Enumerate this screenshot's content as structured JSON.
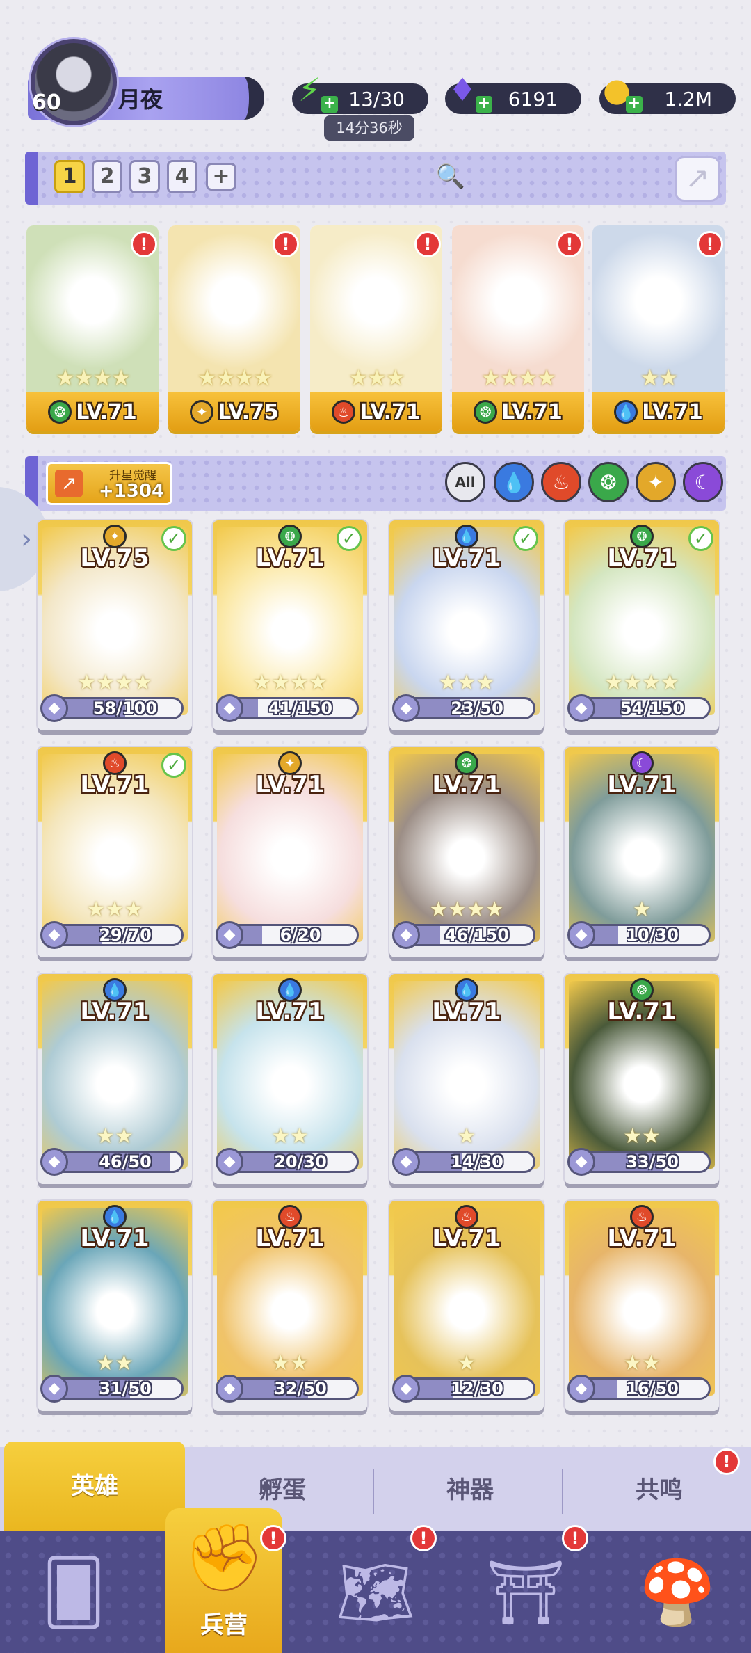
{
  "player": {
    "level": "60",
    "name": "月夜"
  },
  "resources": {
    "energy": "13/30",
    "energy_timer": "14分36秒",
    "gems": "6191",
    "gold": "1.2M"
  },
  "team_tabs": [
    "1",
    "2",
    "3",
    "4",
    "+"
  ],
  "team": [
    {
      "level": "LV.71",
      "stars": "★★★★",
      "element": "wind",
      "element_color": "#3aa84a"
    },
    {
      "level": "LV.75",
      "stars": "★★★★",
      "element": "light",
      "element_color": "#e3a82a"
    },
    {
      "level": "LV.71",
      "stars": "★★★",
      "element": "fire",
      "element_color": "#e04a2a"
    },
    {
      "level": "LV.71",
      "stars": "★★★★",
      "element": "wind",
      "element_color": "#3aa84a"
    },
    {
      "level": "LV.71",
      "stars": "★★",
      "element": "water",
      "element_color": "#3a7ae0"
    }
  ],
  "awaken": {
    "title": "升星觉醒",
    "value": "+1304"
  },
  "filters": [
    {
      "label": "All",
      "color": "#e8e8ee",
      "icon": "all"
    },
    {
      "label": "",
      "color": "#3a7ae0",
      "icon": "water"
    },
    {
      "label": "",
      "color": "#e04a2a",
      "icon": "fire"
    },
    {
      "label": "",
      "color": "#3aa84a",
      "icon": "wind"
    },
    {
      "label": "",
      "color": "#e3a82a",
      "icon": "light"
    },
    {
      "label": "",
      "color": "#8a4ad8",
      "icon": "dark"
    }
  ],
  "heroes": [
    {
      "level": "LV.75",
      "shards": "58/100",
      "progress": 0.58,
      "stars": "★★★★",
      "element": "light",
      "element_color": "#e3a82a",
      "checked": true,
      "art": "#f3e7c8"
    },
    {
      "level": "LV.71",
      "shards": "41/150",
      "progress": 0.27,
      "stars": "★★★★",
      "element": "wind",
      "element_color": "#3aa84a",
      "checked": true,
      "art": "#fbe9a8"
    },
    {
      "level": "LV.71",
      "shards": "23/50",
      "progress": 0.46,
      "stars": "★★★",
      "element": "water",
      "element_color": "#3a7ae0",
      "checked": true,
      "art": "#c9d6ef"
    },
    {
      "level": "LV.71",
      "shards": "54/150",
      "progress": 0.36,
      "stars": "★★★★",
      "element": "wind",
      "element_color": "#3aa84a",
      "checked": true,
      "art": "#d4e6c0"
    },
    {
      "level": "LV.71",
      "shards": "29/70",
      "progress": 0.41,
      "stars": "★★★",
      "element": "fire",
      "element_color": "#e04a2a",
      "checked": true,
      "art": "#f4e6bc"
    },
    {
      "level": "LV.71",
      "shards": "6/20",
      "progress": 0.3,
      "stars": "",
      "element": "light",
      "element_color": "#e3a82a",
      "checked": false,
      "art": "#f6dede"
    },
    {
      "level": "LV.71",
      "shards": "46/150",
      "progress": 0.31,
      "stars": "★★★★",
      "element": "wind",
      "element_color": "#3aa84a",
      "checked": false,
      "art": "#9c8e86"
    },
    {
      "level": "LV.71",
      "shards": "10/30",
      "progress": 0.33,
      "stars": "★",
      "element": "dark",
      "element_color": "#8a4ad8",
      "checked": false,
      "art": "#7f9c9a"
    },
    {
      "level": "LV.71",
      "shards": "46/50",
      "progress": 0.92,
      "stars": "★★",
      "element": "water",
      "element_color": "#3a7ae0",
      "checked": false,
      "art": "#aecbd4"
    },
    {
      "level": "LV.71",
      "shards": "20/30",
      "progress": 0.67,
      "stars": "★★",
      "element": "water",
      "element_color": "#3a7ae0",
      "checked": false,
      "art": "#c6e3ec"
    },
    {
      "level": "LV.71",
      "shards": "14/30",
      "progress": 0.47,
      "stars": "★",
      "element": "water",
      "element_color": "#3a7ae0",
      "checked": false,
      "art": "#d9e0ee"
    },
    {
      "level": "LV.71",
      "shards": "33/50",
      "progress": 0.66,
      "stars": "★★",
      "element": "wind",
      "element_color": "#3aa84a",
      "checked": false,
      "art": "#4a5a3a"
    },
    {
      "level": "LV.71",
      "shards": "31/50",
      "progress": 0.62,
      "stars": "★★",
      "element": "water",
      "element_color": "#3a7ae0",
      "checked": false,
      "art": "#6aa6b8"
    },
    {
      "level": "LV.71",
      "shards": "32/50",
      "progress": 0.64,
      "stars": "★★",
      "element": "fire",
      "element_color": "#e04a2a",
      "checked": false,
      "art": "#f0c36a"
    },
    {
      "level": "LV.71",
      "shards": "12/30",
      "progress": 0.4,
      "stars": "★",
      "element": "fire",
      "element_color": "#e04a2a",
      "checked": false,
      "art": "#e6c25a"
    },
    {
      "level": "LV.71",
      "shards": "16/50",
      "progress": 0.32,
      "stars": "★★",
      "element": "fire",
      "element_color": "#e04a2a",
      "checked": false,
      "art": "#e7b56a"
    }
  ],
  "sub_tabs": [
    {
      "label": "英雄",
      "active": true
    },
    {
      "label": "孵蛋",
      "active": false
    },
    {
      "label": "神器",
      "active": false
    },
    {
      "label": "共鸣",
      "active": false
    }
  ],
  "nav": {
    "active_label": "兵营",
    "items": [
      "cards-icon",
      "barracks-icon",
      "map-icon",
      "temple-icon",
      "mushroom-icon"
    ]
  }
}
